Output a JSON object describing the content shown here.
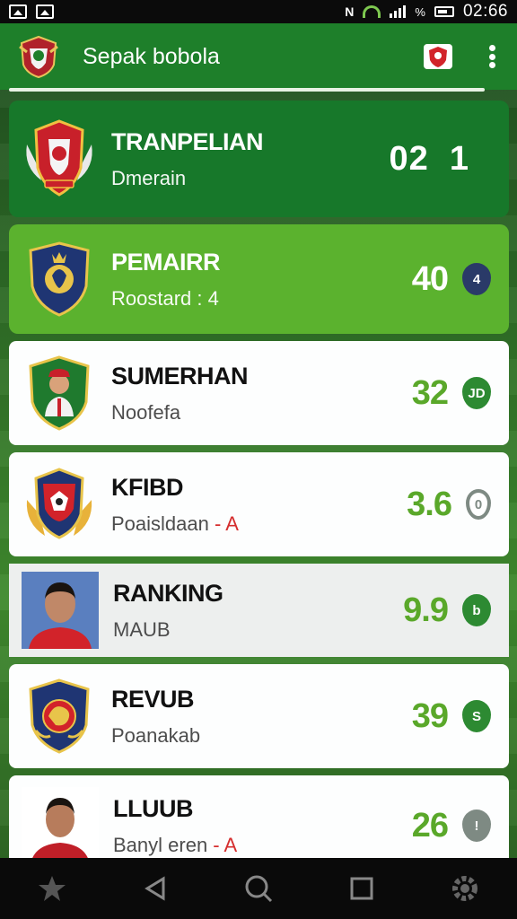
{
  "status_bar": {
    "left_icons": [
      "image-icon",
      "gallery-icon"
    ],
    "nfc": "N",
    "signal_text": "%",
    "time": "02:66"
  },
  "app_bar": {
    "title": "Sepak bobola",
    "logo": "club-crest-icon",
    "action_icon": "shield-badge-icon",
    "more_icon": "more-vert-icon"
  },
  "colors": {
    "app_bar": "#1e7f2a",
    "dark_card": "#17782a",
    "lime_card": "#5bb22e",
    "score_green": "#5aa82a",
    "accent_red": "#d32323"
  },
  "rows": [
    {
      "name": "TRANPELIAN",
      "sub": "Dmerain",
      "sub_red": "",
      "score": "02",
      "badge": "1",
      "style": "dark",
      "icon": "red-crest-icon"
    },
    {
      "name": "PEMAIRR",
      "sub": "Roostard : 4",
      "sub_red": "",
      "score": "40",
      "badge": "4",
      "style": "lime",
      "icon": "blue-crest-icon"
    },
    {
      "name": "SUMERHAN",
      "sub": "Noofefa",
      "sub_red": "",
      "score": "32",
      "badge": "JD",
      "style": "white",
      "icon": "player-crest-icon"
    },
    {
      "name": "KFIBD",
      "sub": "Poaisldaan ",
      "sub_red": "- A",
      "score": "3.6",
      "badge": "0",
      "style": "white",
      "icon": "eagle-crest-icon"
    },
    {
      "name": "RANKING",
      "sub": "MAUB",
      "sub_red": "",
      "score": "9.9",
      "badge": "b",
      "style": "grey",
      "icon": "player-photo"
    },
    {
      "name": "REVUB",
      "sub": "Poanakab",
      "sub_red": "",
      "score": "39",
      "badge": "S",
      "style": "white",
      "icon": "dragon-crest-icon"
    },
    {
      "name": "LLUUB",
      "sub": "Banyl eren ",
      "sub_red": "- A",
      "score": "26",
      "badge": "!",
      "style": "white",
      "icon": "player-photo"
    }
  ],
  "bottom_nav": [
    "star-icon",
    "back-icon",
    "search-icon",
    "recents-icon",
    "settings-icon"
  ]
}
